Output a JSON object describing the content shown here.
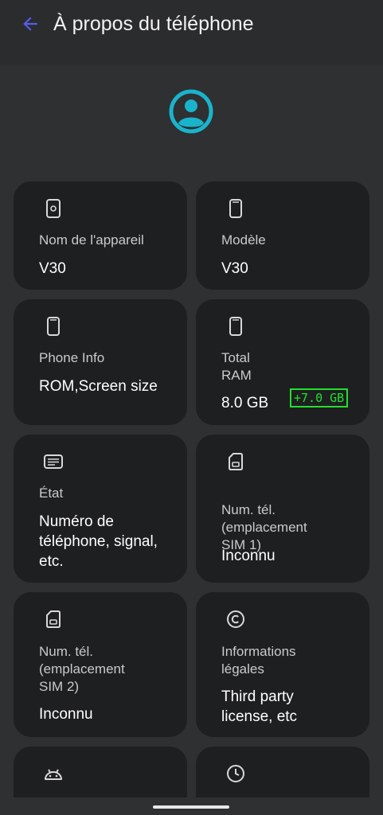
{
  "header": {
    "title": "À propos du téléphone",
    "back_icon": "back-arrow-icon"
  },
  "colors": {
    "accent": "#5b5bf0",
    "avatar": "#19b4cc",
    "ram_badge": "#22e02b",
    "card_bg": "#1e1f21",
    "page_bg": "#2e3032"
  },
  "cards": [
    {
      "icon": "device-name-icon",
      "label": "Nom de l'appareil",
      "value": "V30"
    },
    {
      "icon": "phone-icon",
      "label": "Modèle",
      "value": "V30"
    },
    {
      "icon": "phone-icon",
      "label": "Phone Info",
      "value": "ROM,Screen size"
    },
    {
      "icon": "phone-icon",
      "label": "Total\nRAM",
      "value": "8.0 GB",
      "badge": "+7.0 GB"
    },
    {
      "icon": "status-icon",
      "label": "État",
      "value": "Numéro de\ntéléphone, signal,\netc."
    },
    {
      "icon": "sim-card-icon",
      "label": "Num. tél.\n(emplacement\nSIM 1)",
      "value": "Inconnu"
    },
    {
      "icon": "sim-card-icon",
      "label": "Num. tél.\n(emplacement\nSIM 2)",
      "value": "Inconnu"
    },
    {
      "icon": "copyright-icon",
      "label": "Informations\nlégales",
      "value": "Third party\nlicense, etc"
    },
    {
      "icon": "android-icon"
    },
    {
      "icon": "clock-icon"
    }
  ]
}
